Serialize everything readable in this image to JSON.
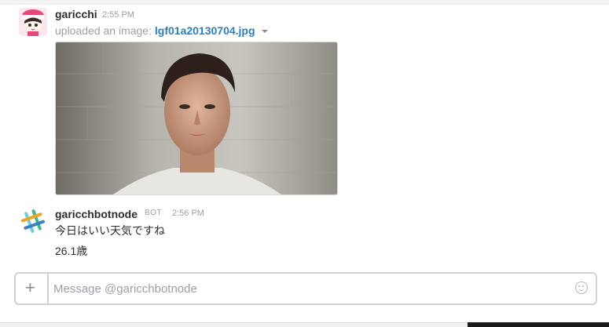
{
  "messages": [
    {
      "username": "garicchi",
      "time": "2:55 PM",
      "upload_prefix": "uploaded an image:",
      "file_name": "lgf01a20130704.jpg",
      "avatar_icon": "anime-character-avatar-icon",
      "image_subject": "portrait photo of a young man"
    },
    {
      "username": "garicchbotnode",
      "badge": "BOT",
      "time": "2:56 PM",
      "lines": [
        "今日はいい天気ですね",
        "26.1歳"
      ],
      "avatar_icon": "slack-hash-icon"
    }
  ],
  "composer": {
    "placeholder": "Message @garicchbotnode",
    "add_icon": "plus-icon",
    "emoji_icon": "smiley-icon"
  },
  "colors": {
    "link": "#2a80b9",
    "text": "#2c2d30",
    "muted": "#9e9ea6"
  }
}
